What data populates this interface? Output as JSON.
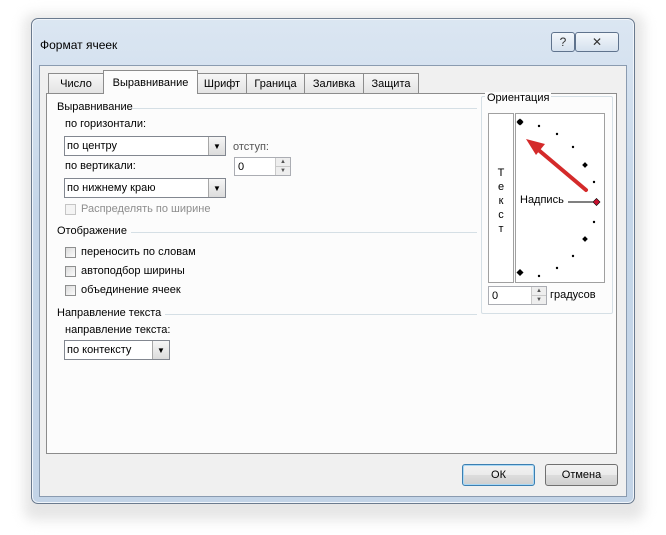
{
  "window": {
    "title": "Формат ячеек",
    "help_glyph": "?",
    "close_glyph": "✕"
  },
  "tabs": [
    {
      "label": "Число",
      "active": false
    },
    {
      "label": "Выравнивание",
      "active": true
    },
    {
      "label": "Шрифт",
      "active": false
    },
    {
      "label": "Граница",
      "active": false
    },
    {
      "label": "Заливка",
      "active": false
    },
    {
      "label": "Защита",
      "active": false
    }
  ],
  "alignment": {
    "section_title": "Выравнивание",
    "horizontal_label": "по горизонтали:",
    "horizontal_value": "по центру",
    "vertical_label": "по вертикали:",
    "vertical_value": "по нижнему краю",
    "indent_label": "отступ:",
    "indent_value": "0",
    "distributed_label": "Распределять по ширине"
  },
  "display": {
    "section_title": "Отображение",
    "wrap_label": "переносить по словам",
    "shrink_label": "автоподбор ширины",
    "merge_label": "объединение ячеек"
  },
  "text_direction": {
    "section_title": "Направление текста",
    "direction_label": "направление текста:",
    "direction_value": "по контексту"
  },
  "orientation": {
    "section_title": "Ориентация",
    "vertical_text": [
      "Т",
      "е",
      "к",
      "с",
      "т"
    ],
    "dial_label": "Надпись",
    "degrees_value": "0",
    "degrees_label": "градусов"
  },
  "buttons": {
    "ok": "ОК",
    "cancel": "Отмена"
  },
  "colors": {
    "annotation_arrow": "#d42a2a",
    "dial_marker": "#c8102e"
  }
}
